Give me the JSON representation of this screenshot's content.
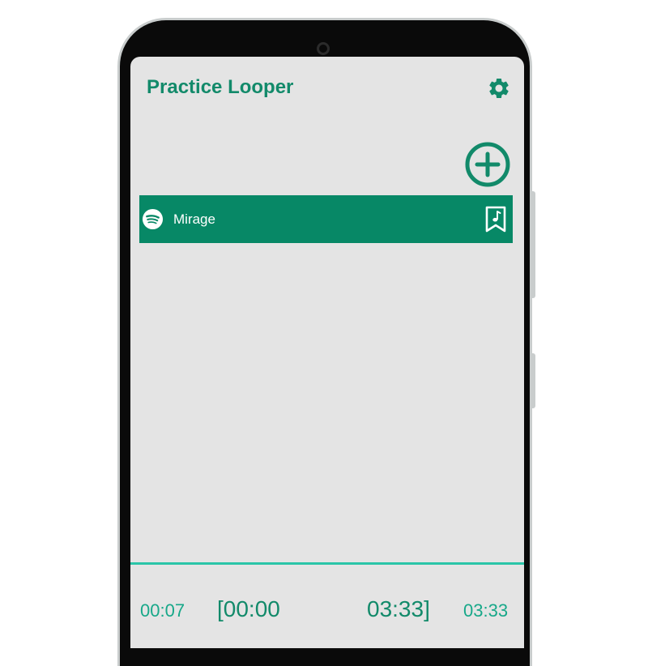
{
  "app": {
    "title": "Practice Looper"
  },
  "icons": {
    "settings": "gear-icon",
    "add": "plus-circle-icon",
    "source": "spotify-icon",
    "song_action": "music-bookmark-icon"
  },
  "colors": {
    "accent": "#128a6a",
    "row_background": "#078866",
    "timeline": "#2ac5a8",
    "screen_background": "#e4e4e4"
  },
  "songs": [
    {
      "title": "Mirage"
    }
  ],
  "player": {
    "current_time": "00:07",
    "loop_start": "[00:00",
    "loop_end": "03:33]",
    "total_time": "03:33"
  }
}
